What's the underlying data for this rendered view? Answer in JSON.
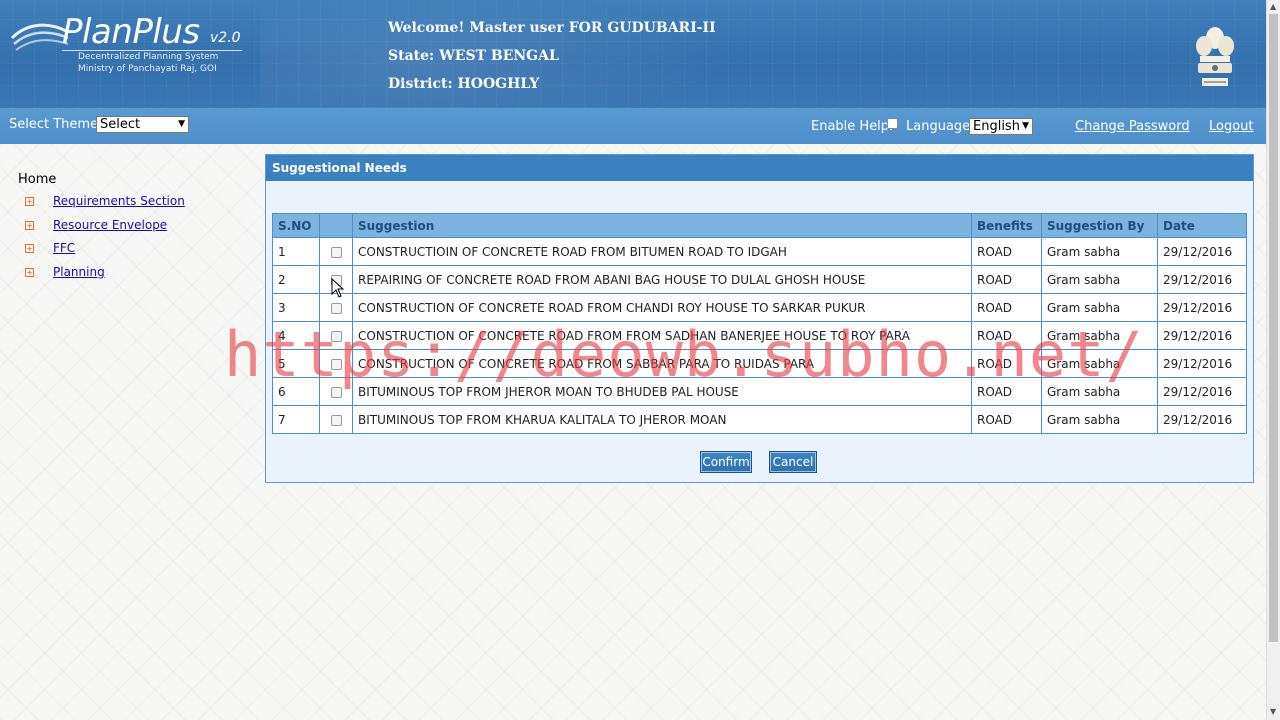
{
  "header": {
    "logo": {
      "title": "PlanPlus",
      "version": "v2.0",
      "subtitle_1": "Decentralized Planning System",
      "subtitle_2": "Ministry of Panchayati Raj, GOI"
    },
    "welcome_line": "Welcome!  Master user FOR GUDUBARI-II",
    "state_line": "State: WEST BENGAL",
    "district_line": "District: HOOGHLY",
    "emblem_icon": "national-emblem-icon"
  },
  "toolbar": {
    "theme_label": "Select Theme",
    "theme_select_value": "Select",
    "enable_help_label": "Enable Help:",
    "language_label": "Language",
    "language_select_value": "English",
    "change_password": "Change Password",
    "logout": "Logout"
  },
  "sidebar": {
    "home": "Home",
    "items": [
      {
        "label": "Requirements Section"
      },
      {
        "label": "Resource Envelope"
      },
      {
        "label": "FFC"
      },
      {
        "label": "Planning"
      }
    ]
  },
  "panel": {
    "title": "Suggestional Needs",
    "columns": [
      "S.NO",
      "",
      "Suggestion",
      "Benefits",
      "Suggestion By",
      "Date"
    ],
    "rows": [
      {
        "sno": "1",
        "suggestion": "CONSTRUCTIOIN OF CONCRETE ROAD FROM BITUMEN ROAD TO IDGAH",
        "benefits": "ROAD",
        "by": "Gram sabha",
        "date": "29/12/2016"
      },
      {
        "sno": "2",
        "suggestion": "REPAIRING OF CONCRETE ROAD FROM ABANI BAG HOUSE TO DULAL GHOSH HOUSE",
        "benefits": "ROAD",
        "by": "Gram sabha",
        "date": "29/12/2016"
      },
      {
        "sno": "3",
        "suggestion": "CONSTRUCTION OF CONCRETE ROAD FROM CHANDI ROY HOUSE TO SARKAR PUKUR",
        "benefits": "ROAD",
        "by": "Gram sabha",
        "date": "29/12/2016"
      },
      {
        "sno": "4",
        "suggestion": "CONSTRUCTION OF CONCRETE ROAD FROM FROM SADHAN BANERJEE HOUSE TO ROY PARA",
        "benefits": "ROAD",
        "by": "Gram sabha",
        "date": "29/12/2016"
      },
      {
        "sno": "5",
        "suggestion": "CONSTRUCTION OF CONCRETE ROAD FROM SABBAR PARA TO RUIDAS PARA",
        "benefits": "ROAD",
        "by": "Gram sabha",
        "date": "29/12/2016"
      },
      {
        "sno": "6",
        "suggestion": "BITUMINOUS TOP FROM JHEROR MOAN TO BHUDEB PAL HOUSE",
        "benefits": "ROAD",
        "by": "Gram sabha",
        "date": "29/12/2016"
      },
      {
        "sno": "7",
        "suggestion": "BITUMINOUS TOP FROM KHARUA KALITALA TO JHEROR MOAN",
        "benefits": "ROAD",
        "by": "Gram sabha",
        "date": "29/12/2016"
      }
    ],
    "confirm_label": "Confirm",
    "cancel_label": "Cancel"
  },
  "watermark": "https://deowb.subho.net/"
}
